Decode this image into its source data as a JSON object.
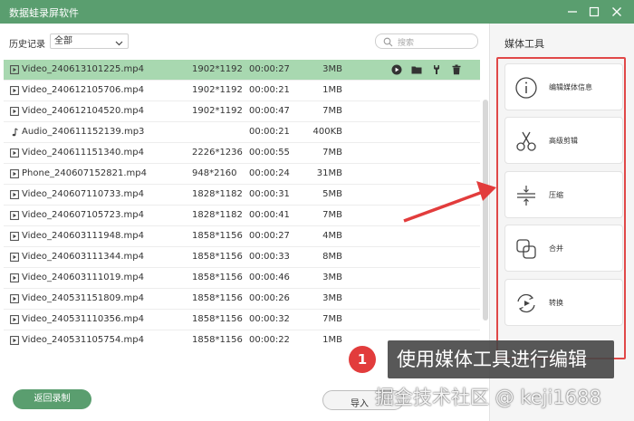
{
  "window": {
    "title": "数据蛙录屏软件",
    "controls": [
      "minimize-icon",
      "maximize-icon",
      "close-icon"
    ]
  },
  "toolbar": {
    "history_label": "历史记录",
    "filter_value": "全部",
    "search_placeholder": "搜索"
  },
  "recordings": [
    {
      "name": "Video_240613101225.mp4",
      "resolution": "1902*1192",
      "duration": "00:00:27",
      "size": "3MB",
      "type": "video",
      "selected": true
    },
    {
      "name": "Video_240612105706.mp4",
      "resolution": "1902*1192",
      "duration": "00:00:21",
      "size": "1MB",
      "type": "video"
    },
    {
      "name": "Video_240612104520.mp4",
      "resolution": "1902*1192",
      "duration": "00:00:47",
      "size": "7MB",
      "type": "video"
    },
    {
      "name": "Audio_240611152139.mp3",
      "resolution": "",
      "duration": "00:00:21",
      "size": "400KB",
      "type": "audio"
    },
    {
      "name": "Video_240611151340.mp4",
      "resolution": "2226*1236",
      "duration": "00:00:55",
      "size": "7MB",
      "type": "video"
    },
    {
      "name": "Phone_240607152821.mp4",
      "resolution": "948*2160",
      "duration": "00:00:24",
      "size": "31MB",
      "type": "video"
    },
    {
      "name": "Video_240607110733.mp4",
      "resolution": "1828*1182",
      "duration": "00:00:31",
      "size": "5MB",
      "type": "video"
    },
    {
      "name": "Video_240607105723.mp4",
      "resolution": "1828*1182",
      "duration": "00:00:41",
      "size": "7MB",
      "type": "video"
    },
    {
      "name": "Video_240603111948.mp4",
      "resolution": "1858*1156",
      "duration": "00:00:27",
      "size": "4MB",
      "type": "video"
    },
    {
      "name": "Video_240603111344.mp4",
      "resolution": "1858*1156",
      "duration": "00:00:33",
      "size": "8MB",
      "type": "video"
    },
    {
      "name": "Video_240603111019.mp4",
      "resolution": "1858*1156",
      "duration": "00:00:46",
      "size": "3MB",
      "type": "video"
    },
    {
      "name": "Video_240531151809.mp4",
      "resolution": "1858*1156",
      "duration": "00:00:26",
      "size": "3MB",
      "type": "video"
    },
    {
      "name": "Video_240531110356.mp4",
      "resolution": "1858*1156",
      "duration": "00:00:32",
      "size": "7MB",
      "type": "video"
    },
    {
      "name": "Video_240531105754.mp4",
      "resolution": "1858*1156",
      "duration": "00:00:22",
      "size": "1MB",
      "type": "video"
    }
  ],
  "row_actions": [
    "play-icon",
    "folder-icon",
    "edit-tool-icon",
    "delete-icon"
  ],
  "footer": {
    "back_label": "返回录制",
    "import_label": "导入"
  },
  "media_tools": {
    "title": "媒体工具",
    "items": [
      {
        "label": "编辑媒体信息",
        "icon": "info-icon"
      },
      {
        "label": "高级剪辑",
        "icon": "scissors-icon"
      },
      {
        "label": "压缩",
        "icon": "compress-icon"
      },
      {
        "label": "合并",
        "icon": "merge-icon"
      },
      {
        "label": "转换",
        "icon": "convert-icon"
      }
    ]
  },
  "annotation": {
    "step_number": "1",
    "text": "使用媒体工具进行编辑"
  },
  "watermark": "掘金技术社区 @ keji1688",
  "colors": {
    "accent": "#5a9e6f",
    "selected_row": "#a8d8b0",
    "annotation_red": "#e23c3c"
  }
}
